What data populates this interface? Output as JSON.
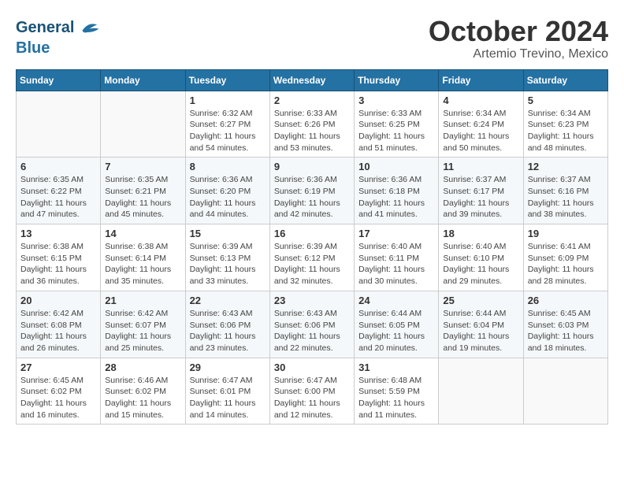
{
  "header": {
    "logo_line1": "General",
    "logo_line2": "Blue",
    "month": "October 2024",
    "location": "Artemio Trevino, Mexico"
  },
  "weekdays": [
    "Sunday",
    "Monday",
    "Tuesday",
    "Wednesday",
    "Thursday",
    "Friday",
    "Saturday"
  ],
  "weeks": [
    [
      {
        "day": "",
        "info": ""
      },
      {
        "day": "",
        "info": ""
      },
      {
        "day": "1",
        "info": "Sunrise: 6:32 AM\nSunset: 6:27 PM\nDaylight: 11 hours and 54 minutes."
      },
      {
        "day": "2",
        "info": "Sunrise: 6:33 AM\nSunset: 6:26 PM\nDaylight: 11 hours and 53 minutes."
      },
      {
        "day": "3",
        "info": "Sunrise: 6:33 AM\nSunset: 6:25 PM\nDaylight: 11 hours and 51 minutes."
      },
      {
        "day": "4",
        "info": "Sunrise: 6:34 AM\nSunset: 6:24 PM\nDaylight: 11 hours and 50 minutes."
      },
      {
        "day": "5",
        "info": "Sunrise: 6:34 AM\nSunset: 6:23 PM\nDaylight: 11 hours and 48 minutes."
      }
    ],
    [
      {
        "day": "6",
        "info": "Sunrise: 6:35 AM\nSunset: 6:22 PM\nDaylight: 11 hours and 47 minutes."
      },
      {
        "day": "7",
        "info": "Sunrise: 6:35 AM\nSunset: 6:21 PM\nDaylight: 11 hours and 45 minutes."
      },
      {
        "day": "8",
        "info": "Sunrise: 6:36 AM\nSunset: 6:20 PM\nDaylight: 11 hours and 44 minutes."
      },
      {
        "day": "9",
        "info": "Sunrise: 6:36 AM\nSunset: 6:19 PM\nDaylight: 11 hours and 42 minutes."
      },
      {
        "day": "10",
        "info": "Sunrise: 6:36 AM\nSunset: 6:18 PM\nDaylight: 11 hours and 41 minutes."
      },
      {
        "day": "11",
        "info": "Sunrise: 6:37 AM\nSunset: 6:17 PM\nDaylight: 11 hours and 39 minutes."
      },
      {
        "day": "12",
        "info": "Sunrise: 6:37 AM\nSunset: 6:16 PM\nDaylight: 11 hours and 38 minutes."
      }
    ],
    [
      {
        "day": "13",
        "info": "Sunrise: 6:38 AM\nSunset: 6:15 PM\nDaylight: 11 hours and 36 minutes."
      },
      {
        "day": "14",
        "info": "Sunrise: 6:38 AM\nSunset: 6:14 PM\nDaylight: 11 hours and 35 minutes."
      },
      {
        "day": "15",
        "info": "Sunrise: 6:39 AM\nSunset: 6:13 PM\nDaylight: 11 hours and 33 minutes."
      },
      {
        "day": "16",
        "info": "Sunrise: 6:39 AM\nSunset: 6:12 PM\nDaylight: 11 hours and 32 minutes."
      },
      {
        "day": "17",
        "info": "Sunrise: 6:40 AM\nSunset: 6:11 PM\nDaylight: 11 hours and 30 minutes."
      },
      {
        "day": "18",
        "info": "Sunrise: 6:40 AM\nSunset: 6:10 PM\nDaylight: 11 hours and 29 minutes."
      },
      {
        "day": "19",
        "info": "Sunrise: 6:41 AM\nSunset: 6:09 PM\nDaylight: 11 hours and 28 minutes."
      }
    ],
    [
      {
        "day": "20",
        "info": "Sunrise: 6:42 AM\nSunset: 6:08 PM\nDaylight: 11 hours and 26 minutes."
      },
      {
        "day": "21",
        "info": "Sunrise: 6:42 AM\nSunset: 6:07 PM\nDaylight: 11 hours and 25 minutes."
      },
      {
        "day": "22",
        "info": "Sunrise: 6:43 AM\nSunset: 6:06 PM\nDaylight: 11 hours and 23 minutes."
      },
      {
        "day": "23",
        "info": "Sunrise: 6:43 AM\nSunset: 6:06 PM\nDaylight: 11 hours and 22 minutes."
      },
      {
        "day": "24",
        "info": "Sunrise: 6:44 AM\nSunset: 6:05 PM\nDaylight: 11 hours and 20 minutes."
      },
      {
        "day": "25",
        "info": "Sunrise: 6:44 AM\nSunset: 6:04 PM\nDaylight: 11 hours and 19 minutes."
      },
      {
        "day": "26",
        "info": "Sunrise: 6:45 AM\nSunset: 6:03 PM\nDaylight: 11 hours and 18 minutes."
      }
    ],
    [
      {
        "day": "27",
        "info": "Sunrise: 6:45 AM\nSunset: 6:02 PM\nDaylight: 11 hours and 16 minutes."
      },
      {
        "day": "28",
        "info": "Sunrise: 6:46 AM\nSunset: 6:02 PM\nDaylight: 11 hours and 15 minutes."
      },
      {
        "day": "29",
        "info": "Sunrise: 6:47 AM\nSunset: 6:01 PM\nDaylight: 11 hours and 14 minutes."
      },
      {
        "day": "30",
        "info": "Sunrise: 6:47 AM\nSunset: 6:00 PM\nDaylight: 11 hours and 12 minutes."
      },
      {
        "day": "31",
        "info": "Sunrise: 6:48 AM\nSunset: 5:59 PM\nDaylight: 11 hours and 11 minutes."
      },
      {
        "day": "",
        "info": ""
      },
      {
        "day": "",
        "info": ""
      }
    ]
  ]
}
